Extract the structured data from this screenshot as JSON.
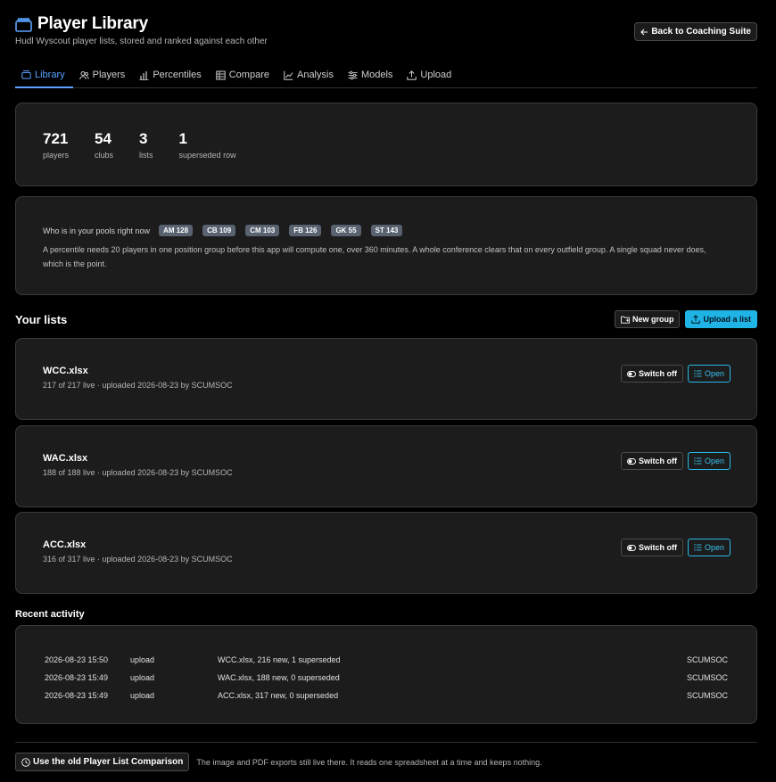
{
  "header": {
    "title": "Player Library",
    "subtitle": "Hudl Wyscout player lists, stored and ranked against each other",
    "back_label": "Back to Coaching Suite"
  },
  "tabs": [
    {
      "label": "Library",
      "icon": "archive-icon",
      "active": true
    },
    {
      "label": "Players",
      "icon": "users-icon",
      "active": false
    },
    {
      "label": "Percentiles",
      "icon": "bar-chart-icon",
      "active": false
    },
    {
      "label": "Compare",
      "icon": "table-icon",
      "active": false
    },
    {
      "label": "Analysis",
      "icon": "line-chart-icon",
      "active": false
    },
    {
      "label": "Models",
      "icon": "sliders-icon",
      "active": false
    },
    {
      "label": "Upload",
      "icon": "upload-icon",
      "active": false
    }
  ],
  "stats": [
    {
      "value": "721",
      "label": "players"
    },
    {
      "value": "54",
      "label": "clubs"
    },
    {
      "value": "3",
      "label": "lists"
    },
    {
      "value": "1",
      "label": "superseded row"
    }
  ],
  "pools": {
    "label": "Who is in your pools right now",
    "badges": [
      "AM 128",
      "CB 109",
      "CM 103",
      "FB 126",
      "GK 55",
      "ST 143"
    ],
    "text": "A percentile needs 20 players in one position group before this app will compute one, over 360 minutes. A whole conference clears that on every outfield group. A single squad never does, which is the point."
  },
  "lists_section": {
    "title": "Your lists",
    "new_group_label": "New group",
    "upload_label": "Upload a list"
  },
  "lists": [
    {
      "name": "WCC.xlsx",
      "meta": "217 of 217 live · uploaded 2026-08-23 by SCUMSOC",
      "switch_label": "Switch off",
      "open_label": "Open"
    },
    {
      "name": "WAC.xlsx",
      "meta": "188 of 188 live · uploaded 2026-08-23 by SCUMSOC",
      "switch_label": "Switch off",
      "open_label": "Open"
    },
    {
      "name": "ACC.xlsx",
      "meta": "316 of 317 live · uploaded 2026-08-23 by SCUMSOC",
      "switch_label": "Switch off",
      "open_label": "Open"
    }
  ],
  "recent": {
    "title": "Recent activity",
    "rows": [
      {
        "time": "2026-08-23 15:50",
        "type": "upload",
        "desc": "WCC.xlsx, 216 new, 1 superseded",
        "user": "SCUMSOC"
      },
      {
        "time": "2026-08-23 15:49",
        "type": "upload",
        "desc": "WAC.xlsx, 188 new, 0 superseded",
        "user": "SCUMSOC"
      },
      {
        "time": "2026-08-23 15:49",
        "type": "upload",
        "desc": "ACC.xlsx, 317 new, 0 superseded",
        "user": "SCUMSOC"
      }
    ]
  },
  "footer": {
    "button_label": "Use the old Player List Comparison",
    "text": "The image and PDF exports still live there. It reads one spreadsheet at a time and keeps nothing."
  },
  "colors": {
    "accent": "#5aa2ff",
    "cyan": "#1fb3e6",
    "card_bg": "#1c1c1c",
    "badge_bg": "#596270"
  }
}
